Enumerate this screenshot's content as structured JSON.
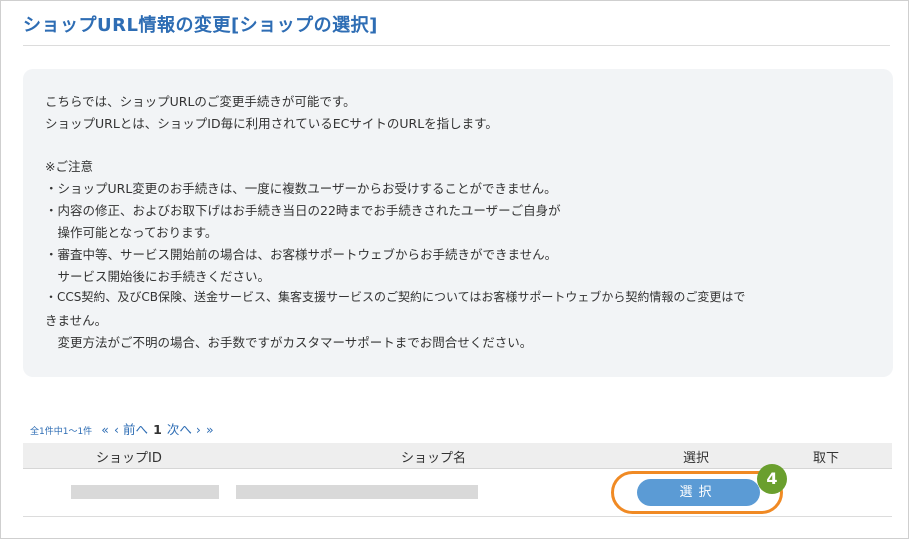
{
  "page": {
    "title": "ショップURL情報の変更[ショップの選択]"
  },
  "notice": {
    "lines": [
      "こちらでは、ショップURLのご変更手続きが可能です。",
      "ショップURLとは、ショップID毎に利用されているECサイトのURLを指します。",
      "※ご注意",
      "・ショップURL変更のお手続きは、一度に複数ユーザーからお受けすることができません。",
      "・内容の修正、およびお取下げはお手続き当日の22時までお手続きされたユーザーご自身が",
      "　操作可能となっております。",
      "・審査中等、サービス開始前の場合は、お客様サポートウェブからお手続きができません。",
      "　サービス開始後にお手続きください。",
      "・CCS契約、及びCB保険、送金サービス、集客支援サービスのご契約についてはお客様サポートウェブから契約情報のご変更はで",
      "きません。",
      "　変更方法がご不明の場合、お手数ですがカスタマーサポートまでお問合せください。"
    ]
  },
  "pagination": {
    "count": "全1件中1〜1件",
    "first": "«",
    "prev": "‹ 前へ",
    "current": "1",
    "next": "次へ ›",
    "last": "»"
  },
  "table": {
    "headers": [
      "ショップID",
      "ショップ名",
      "選択",
      "取下"
    ],
    "rows": [
      {
        "select_label": "選択"
      }
    ]
  },
  "annotation": {
    "step_number": "4",
    "highlight_color": "#f08a24",
    "badge_color": "#6a9f2e"
  },
  "colors": {
    "title": "#2e6db4",
    "button": "#5b9bd5",
    "notice_bg": "#f2f4f6"
  }
}
